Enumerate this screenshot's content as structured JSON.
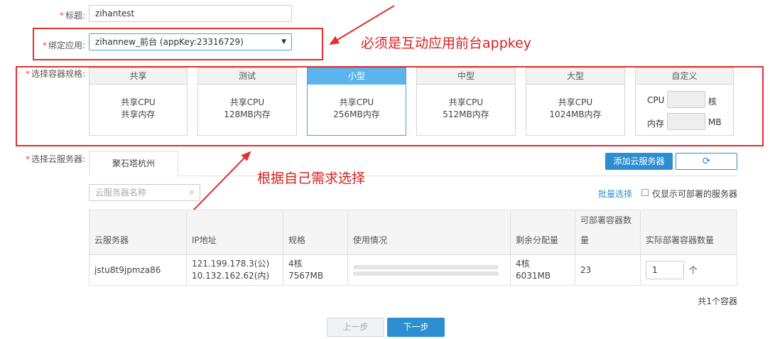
{
  "form": {
    "title_label": "标题:",
    "title_value": "zihantest",
    "app_label": "绑定应用:",
    "app_value": "zihannew_前台 (appKey:23316729)",
    "spec_label": "选择容器规格:",
    "server_label": "选择云服务器:"
  },
  "annotations": {
    "appkey_note": "必须是互动应用前台appkey",
    "choose_note": "根据自己需求选择"
  },
  "specs": [
    {
      "name": "共享",
      "line1": "共享CPU",
      "line2": "共享内存"
    },
    {
      "name": "测试",
      "line1": "共享CPU",
      "line2": "128MB内存"
    },
    {
      "name": "小型",
      "line1": "共享CPU",
      "line2": "256MB内存"
    },
    {
      "name": "中型",
      "line1": "共享CPU",
      "line2": "512MB内存"
    },
    {
      "name": "大型",
      "line1": "共享CPU",
      "line2": "1024MB内存"
    }
  ],
  "custom_spec": {
    "name": "自定义",
    "cpu_label": "CPU",
    "cpu_unit": "核",
    "mem_label": "内存",
    "mem_unit": "MB"
  },
  "server": {
    "region_tab": "聚石塔杭州",
    "add_button": "添加云服务器",
    "search_placeholder": "云服务器名称",
    "batch_select": "批量选择",
    "only_deployable": "仅显示可部署的服务器"
  },
  "table": {
    "headers": [
      "云服务器",
      "IP地址",
      "规格",
      "使用情况",
      "剩余分配量",
      "可部署容器数量",
      "实际部署容器数量"
    ],
    "row": {
      "name": "jstu8t9jpmza86",
      "ip_public": "121.199.178.3(公)",
      "ip_private": "10.132.162.62(内)",
      "spec_cpu": "4核",
      "spec_mem": "7567MB",
      "remain_cpu": "4核",
      "remain_mem": "6031MB",
      "deployable": "23",
      "actual": "1",
      "actual_unit": "个"
    }
  },
  "footer": {
    "total": "共1个容器",
    "prev": "上一步",
    "next": "下一步"
  },
  "colors": {
    "accent": "#2d8fd0",
    "selected": "#5bb4ec",
    "annotation": "#e03030"
  }
}
